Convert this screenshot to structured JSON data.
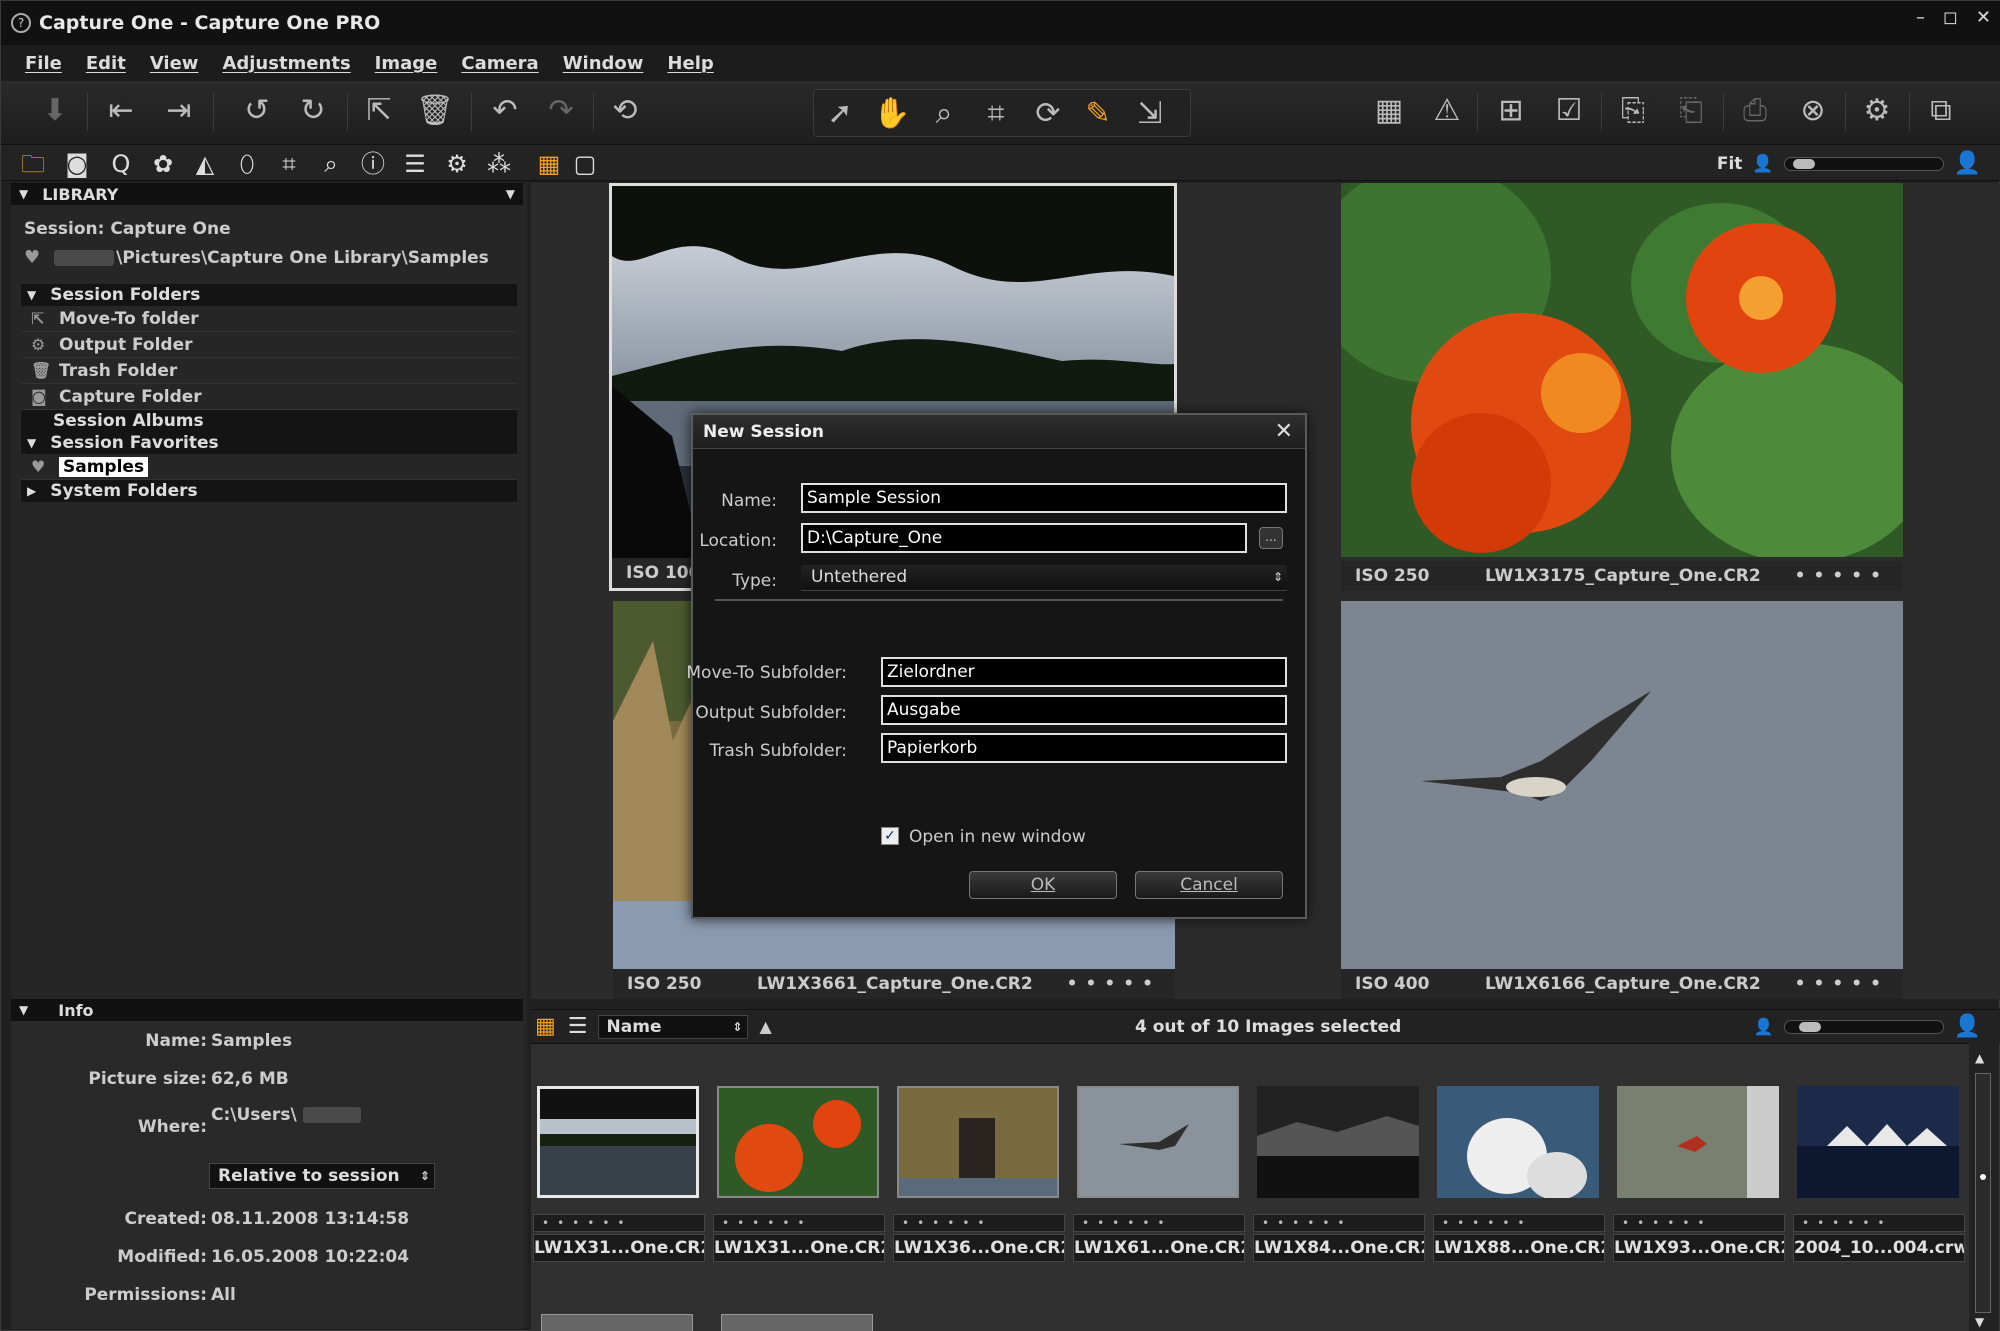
{
  "window": {
    "title": "Capture One - Capture One PRO",
    "controls": [
      "–",
      "◻",
      "✕"
    ]
  },
  "menu": [
    "File",
    "Edit",
    "View",
    "Adjustments",
    "Image",
    "Camera",
    "Window",
    "Help"
  ],
  "panel_bar": {
    "fit_label": "Fit"
  },
  "library": {
    "header": "LIBRARY",
    "session_label": "Session: Capture One",
    "path": "\\Pictures\\Capture One Library\\Samples",
    "session_folders": {
      "label": "Session Folders",
      "items": [
        "Move-To folder",
        "Output Folder",
        "Trash Folder",
        "Capture Folder"
      ]
    },
    "session_albums": "Session Albums",
    "session_favorites": {
      "label": "Session Favorites",
      "items": [
        "Samples"
      ]
    },
    "system_folders": "System Folders"
  },
  "info": {
    "header": "Info",
    "rows": [
      {
        "key": "Name:",
        "value": "Samples"
      },
      {
        "key": "Picture size:",
        "value": "62,6 MB"
      },
      {
        "key": "Where:",
        "value": "C:\\Users\\"
      },
      {
        "key": "Created:",
        "value": "08.11.2008 13:14:58"
      },
      {
        "key": "Modified:",
        "value": "16.05.2008 10:22:04"
      },
      {
        "key": "Permissions:",
        "value": "All"
      }
    ],
    "relative_select": "Relative to session"
  },
  "viewer": {
    "tiles": [
      {
        "iso": "ISO 100",
        "file": "",
        "dots": ""
      },
      {
        "iso": "ISO 250",
        "file": "LW1X3175_Capture_One.CR2",
        "dots": "•••••"
      },
      {
        "iso": "ISO 250",
        "file": "LW1X3661_Capture_One.CR2",
        "dots": "•••••"
      },
      {
        "iso": "ISO 400",
        "file": "LW1X6166_Capture_One.CR2",
        "dots": "•••••"
      }
    ]
  },
  "browser": {
    "sort_field": "Name",
    "selection_status": "4 out of 10 Images selected",
    "thumbs": [
      {
        "name": "LW1X31...One.CR2",
        "dots": "••••••"
      },
      {
        "name": "LW1X31...One.CR2",
        "dots": "••••••"
      },
      {
        "name": "LW1X36...One.CR2",
        "dots": "••••••"
      },
      {
        "name": "LW1X61...One.CR2",
        "dots": "••••••"
      },
      {
        "name": "LW1X84...One.CR2",
        "dots": "••••••"
      },
      {
        "name": "LW1X88...One.CR2",
        "dots": "••••••"
      },
      {
        "name": "LW1X93...One.CR2",
        "dots": "••••••"
      },
      {
        "name": "2004_10...004.crw",
        "dots": "••••••"
      }
    ]
  },
  "dialog": {
    "title": "New Session",
    "close": "✕",
    "name_label": "Name:",
    "name_value": "Sample Session",
    "location_label": "Location:",
    "location_value": "D:\\Capture_One",
    "browse_label": "...",
    "type_label": "Type:",
    "type_value": "Untethered",
    "move_label": "Move-To Subfolder:",
    "move_value": "Zielordner",
    "output_label": "Output Subfolder:",
    "output_value": "Ausgabe",
    "trash_label": "Trash Subfolder:",
    "trash_value": "Papierkorb",
    "open_new_window_label": "Open in new window",
    "open_new_window_checked": "✓",
    "ok": "OK",
    "cancel": "Cancel"
  },
  "colors": {
    "accent": "#f0a020",
    "background": "#202020",
    "dialog": "#151515"
  }
}
